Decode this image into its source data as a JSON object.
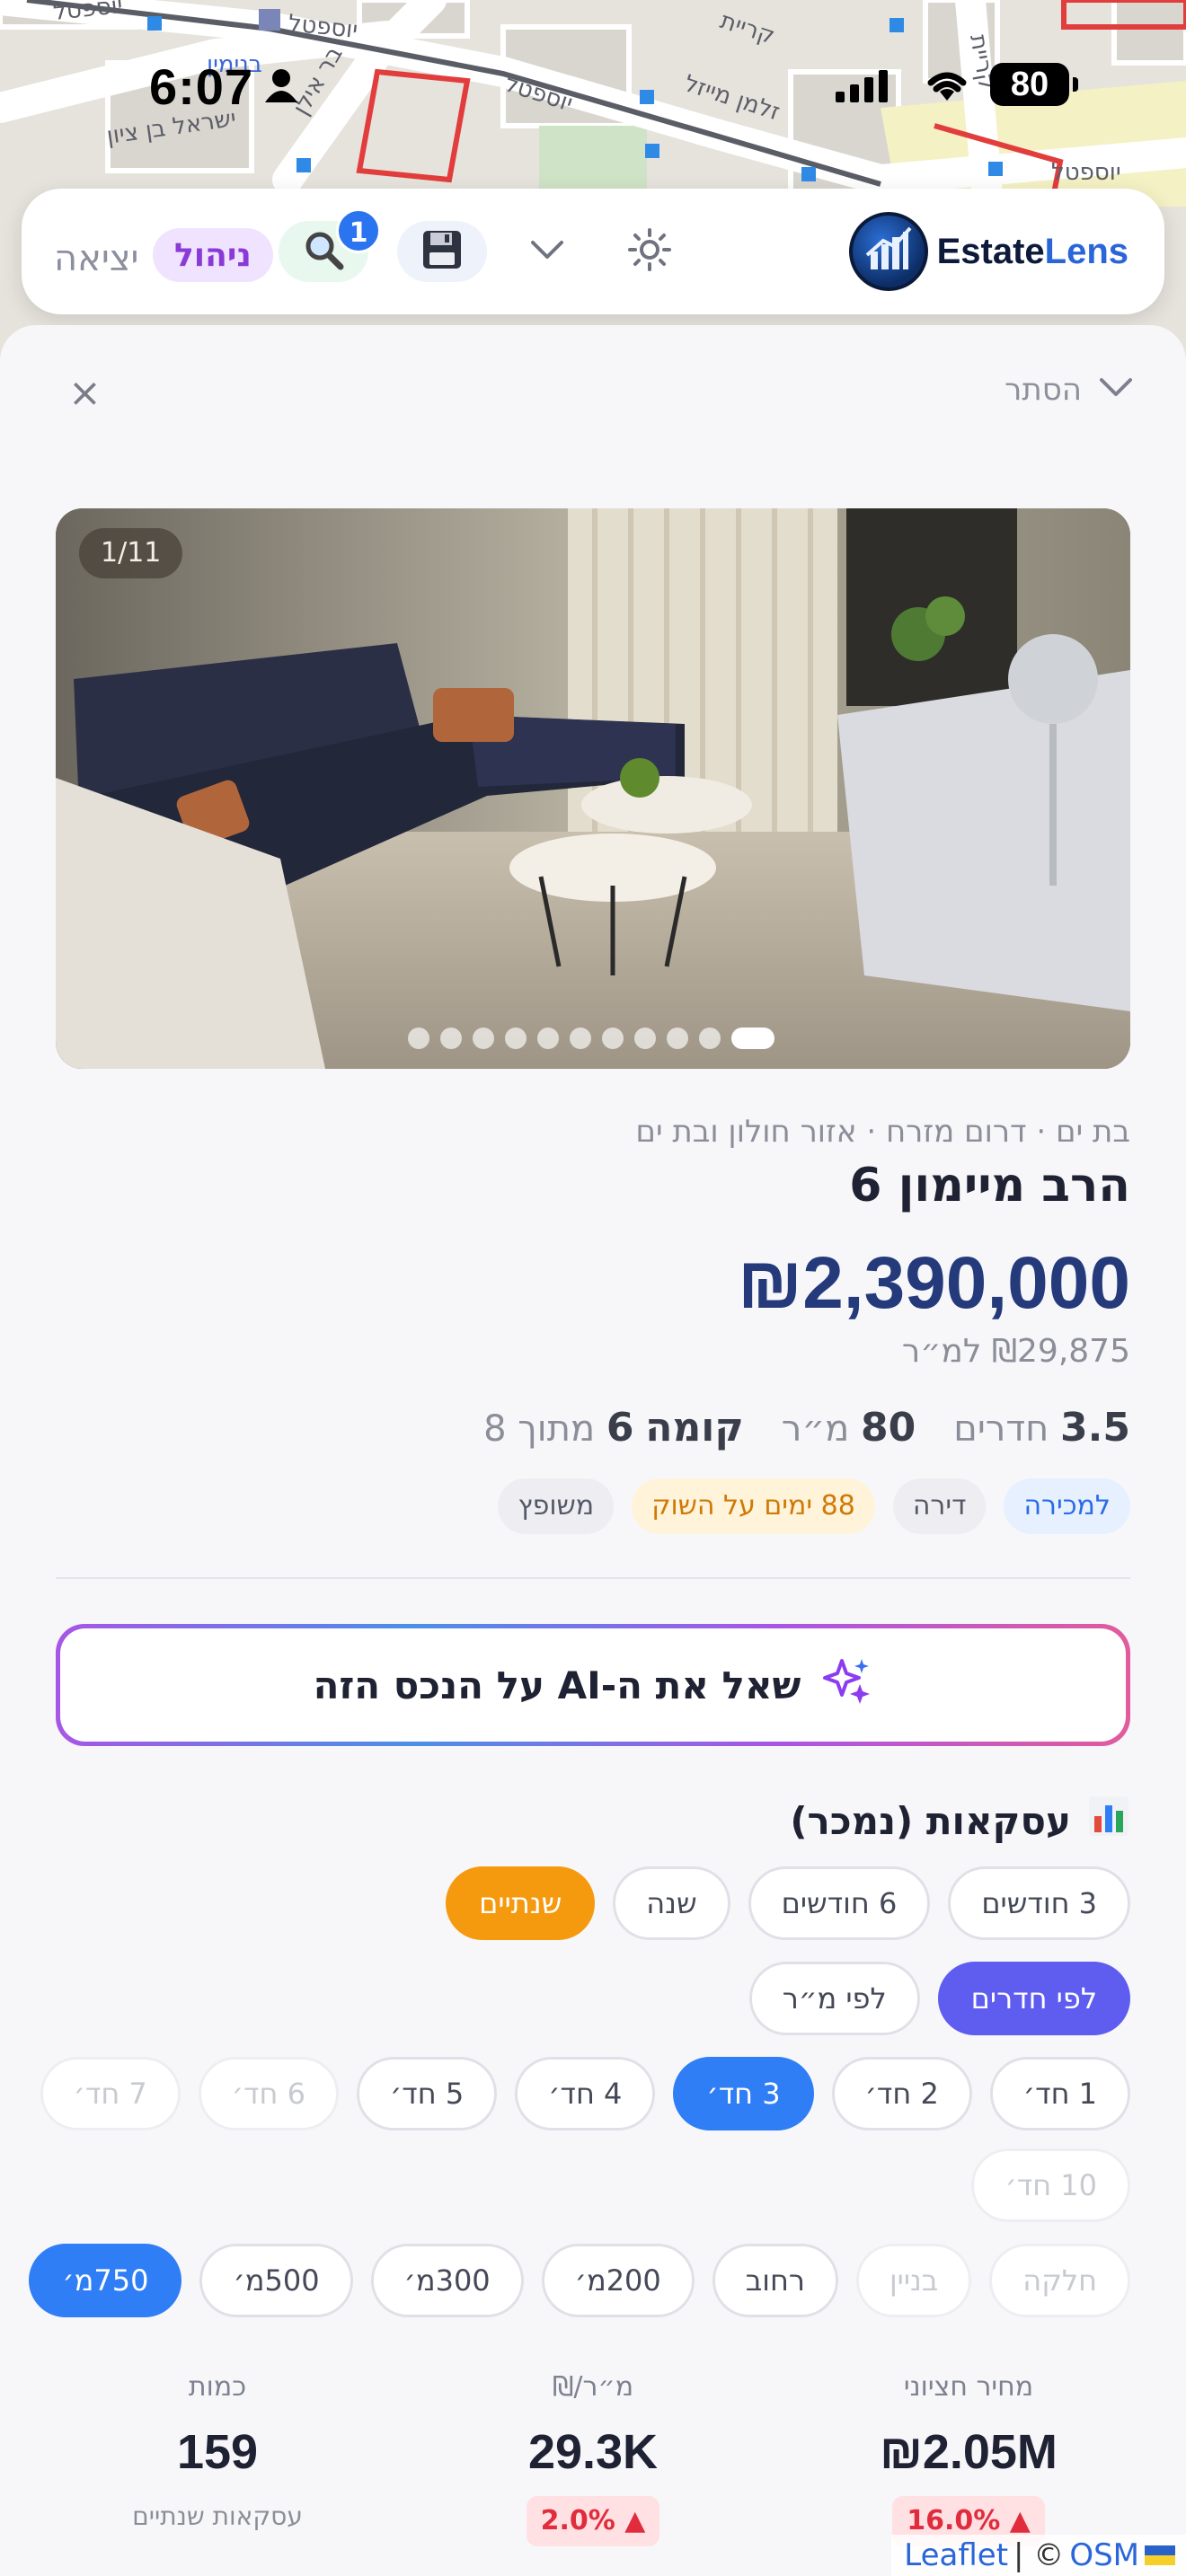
{
  "status_bar": {
    "time": "6:07",
    "battery": "80"
  },
  "map": {
    "labels": [
      "יוספטל",
      "יוספטל",
      "בנימין",
      "בר אילן",
      "ישראל בן ציון",
      "יוספטל",
      "זלמן מייזל",
      "קריית",
      "קריית",
      "יוספטל"
    ]
  },
  "toolbar": {
    "logo_word1": "Estate",
    "logo_word2": "Lens",
    "exit_label": "יציאה",
    "manage_label": "ניהול",
    "search_badge": "1"
  },
  "sheet": {
    "hide_label": "הסתר",
    "close_label": "×"
  },
  "listing": {
    "photo_counter": "1/11",
    "photo_count": 11,
    "active_photo": 1,
    "breadcrumb": "בת ים · דרום מזרח · אזור חולון ובת ים",
    "address": "הרב מיימון 6",
    "price": "₪2,390,000",
    "price_per_sqm": "₪29,875 למ״ר",
    "rooms_value": "3.5",
    "rooms_label": "חדרים",
    "area_value": "80",
    "area_label": "מ״ר",
    "floor_label": "קומה",
    "floor_value": "6",
    "floor_total": "מתוך 8",
    "tags": {
      "for_sale": "למכירה",
      "type": "דירה",
      "days": "88 ימים על השוק",
      "renovated": "משופץ"
    }
  },
  "ai_button": {
    "label": "שאל את ה-AI על הנכס הזה"
  },
  "transactions": {
    "title": "עסקאות (נמכר)",
    "periods": [
      "3 חודשים",
      "6 חודשים",
      "שנה",
      "שנתיים"
    ],
    "selected_period": "שנתיים",
    "modes": [
      "לפי חדרים",
      "לפי מ״ר"
    ],
    "selected_mode": "לפי חדרים",
    "rooms": [
      "1 חד׳",
      "2 חד׳",
      "3 חד׳",
      "4 חד׳",
      "5 חד׳",
      "6 חד׳",
      "7 חד׳"
    ],
    "rooms_extra": "10 חד׳",
    "selected_room": "3 חד׳",
    "scopes": [
      "חלקה",
      "בניין",
      "רחוב",
      "200מ׳",
      "300מ׳",
      "500מ׳",
      "750מ׳"
    ],
    "selected_scope": "750מ׳",
    "stats": {
      "median_label": "מחיר חציוני",
      "median_value": "₪2.05M",
      "median_delta": "16.0% ▲",
      "sqm_label": "₪/מ״ר",
      "sqm_value": "29.3K",
      "sqm_delta": "2.0% ▲",
      "count_label": "כמות",
      "count_value": "159",
      "count_sub": "עסקאות שנתיים"
    }
  },
  "attribution": {
    "leaflet": "Leaflet",
    "sep": "| ©",
    "osm": "OSM"
  }
}
